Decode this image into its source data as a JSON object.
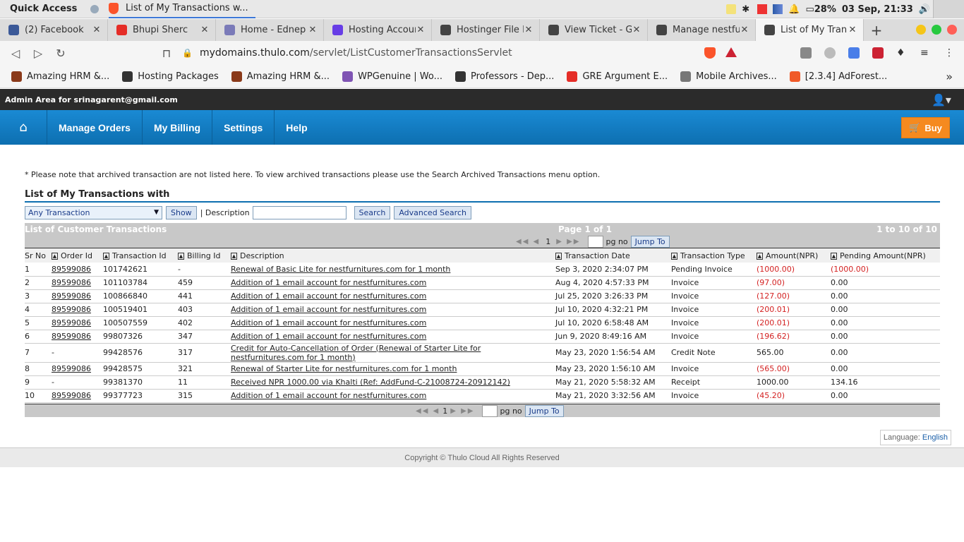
{
  "os": {
    "quick_access": "Quick Access",
    "window_title": "List of My Transactions w...",
    "battery": "28%",
    "datetime": "03 Sep, 21:33"
  },
  "tabs": [
    {
      "label": "(2) Facebook",
      "color": "#3b5998"
    },
    {
      "label": "Bhupi Sherc",
      "color": "#e52d27"
    },
    {
      "label": "Home - Ednep",
      "color": "#7a7ab8"
    },
    {
      "label": "Hosting Accour",
      "color": "#673de6"
    },
    {
      "label": "Hostinger File M",
      "color": "#444444"
    },
    {
      "label": "View Ticket - G",
      "color": "#444444"
    },
    {
      "label": "Manage nestfur",
      "color": "#444444"
    },
    {
      "label": "List of My Tran",
      "color": "#444444",
      "active": true
    }
  ],
  "address": {
    "host": "mydomains.thulo.com",
    "path": "/servlet/ListCustomerTransactionsServlet"
  },
  "bookmarks": [
    {
      "label": "Amazing HRM &...",
      "color": "#8a3a1a"
    },
    {
      "label": "Hosting Packages",
      "color": "#333333"
    },
    {
      "label": "Amazing HRM &...",
      "color": "#8a3a1a"
    },
    {
      "label": "WPGenuine | Wo...",
      "color": "#7f54b3"
    },
    {
      "label": "Professors - Dep...",
      "color": "#333333"
    },
    {
      "label": "GRE Argument E...",
      "color": "#e52d27"
    },
    {
      "label": "Mobile Archives...",
      "color": "#777777"
    },
    {
      "label": "[2.3.4] AdForest...",
      "color": "#f05a28"
    }
  ],
  "admin": {
    "label": "Admin Area for srinagarent@gmail.com"
  },
  "nav": {
    "items": [
      "Manage Orders",
      "My Billing",
      "Settings",
      "Help"
    ],
    "buy": "Buy"
  },
  "content": {
    "note": "* Please note that archived transaction are not listed here. To view archived transactions please use the Search Archived Transactions menu option.",
    "heading": "List of My Transactions with",
    "filter_select": "Any Transaction",
    "show_btn": "Show",
    "desc_label": "| Description",
    "search_btn": "Search",
    "adv_search_btn": "Advanced Search",
    "table_title": "List of Customer Transactions",
    "page_info": "Page 1 of 1",
    "range_info": "1 to 10 of 10",
    "page_num": "1",
    "pg_no": "pg no",
    "jump_to": "Jump To"
  },
  "columns": [
    "Sr No",
    "Order Id",
    "Transaction Id",
    "Billing Id",
    "Description",
    "Transaction Date",
    "Transaction Type",
    "Amount(NPR)",
    "Pending Amount(NPR)"
  ],
  "rows": [
    {
      "sr": "1",
      "order": "89599086",
      "tx": "101742621",
      "billing": "-",
      "desc": "Renewal of Basic Lite for nestfurnitures.com for 1 month",
      "date": "Sep 3, 2020 2:34:07 PM",
      "type": "Pending Invoice",
      "amount": "(1000.00)",
      "pending": "(1000.00)",
      "amount_red": true,
      "pending_red": true
    },
    {
      "sr": "2",
      "order": "89599086",
      "tx": "101103784",
      "billing": "459",
      "desc": "Addition of 1 email account for nestfurnitures.com",
      "date": "Aug 4, 2020 4:57:33 PM",
      "type": "Invoice",
      "amount": "(97.00)",
      "pending": "0.00",
      "amount_red": true
    },
    {
      "sr": "3",
      "order": "89599086",
      "tx": "100866840",
      "billing": "441",
      "desc": "Addition of 1 email account for nestfurnitures.com",
      "date": "Jul 25, 2020 3:26:33 PM",
      "type": "Invoice",
      "amount": "(127.00)",
      "pending": "0.00",
      "amount_red": true
    },
    {
      "sr": "4",
      "order": "89599086",
      "tx": "100519401",
      "billing": "403",
      "desc": "Addition of 1 email account for nestfurnitures.com",
      "date": "Jul 10, 2020 4:32:21 PM",
      "type": "Invoice",
      "amount": "(200.01)",
      "pending": "0.00",
      "amount_red": true
    },
    {
      "sr": "5",
      "order": "89599086",
      "tx": "100507559",
      "billing": "402",
      "desc": "Addition of 1 email account for nestfurnitures.com",
      "date": "Jul 10, 2020 6:58:48 AM",
      "type": "Invoice",
      "amount": "(200.01)",
      "pending": "0.00",
      "amount_red": true
    },
    {
      "sr": "6",
      "order": "89599086",
      "tx": "99807326",
      "billing": "347",
      "desc": "Addition of 1 email account for nestfurnitures.com",
      "date": "Jun 9, 2020 8:49:16 AM",
      "type": "Invoice",
      "amount": "(196.62)",
      "pending": "0.00",
      "amount_red": true
    },
    {
      "sr": "7",
      "order": "-",
      "tx": "99428576",
      "billing": "317",
      "desc": "Credit for Auto-Cancellation of Order (Renewal of Starter Lite for nestfurnitures.com for 1 month)",
      "date": "May 23, 2020 1:56:54 AM",
      "type": "Credit Note",
      "amount": "565.00",
      "pending": "0.00"
    },
    {
      "sr": "8",
      "order": "89599086",
      "tx": "99428575",
      "billing": "321",
      "desc": "Renewal of Starter Lite for nestfurnitures.com for 1 month",
      "date": "May 23, 2020 1:56:10 AM",
      "type": "Invoice",
      "amount": "(565.00)",
      "pending": "0.00",
      "amount_red": true
    },
    {
      "sr": "9",
      "order": "-",
      "tx": "99381370",
      "billing": "11",
      "desc": "Received NPR 1000.00 via Khalti (Ref: AddFund-C-21008724-20912142)",
      "date": "May 21, 2020 5:58:32 AM",
      "type": "Receipt",
      "amount": "1000.00",
      "pending": "134.16"
    },
    {
      "sr": "10",
      "order": "89599086",
      "tx": "99377723",
      "billing": "315",
      "desc": "Addition of 1 email account for nestfurnitures.com",
      "date": "May 21, 2020 3:32:56 AM",
      "type": "Invoice",
      "amount": "(45.20)",
      "pending": "0.00",
      "amount_red": true
    }
  ],
  "language": {
    "label": "Language:",
    "value": "English"
  },
  "footer": "Copyright © Thulo Cloud All Rights Reserved"
}
